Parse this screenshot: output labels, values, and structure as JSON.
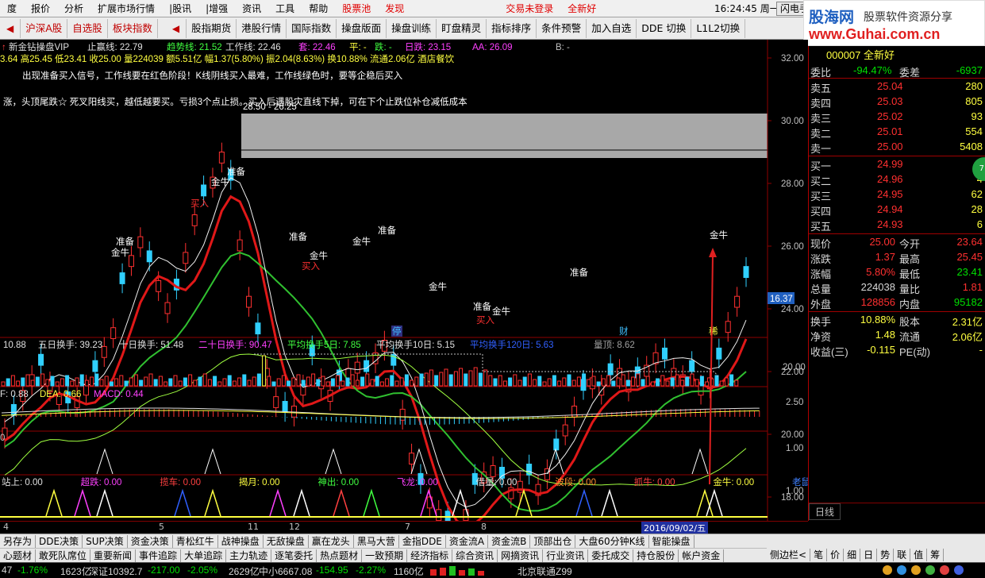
{
  "menu": {
    "items": [
      "度",
      "报价",
      "分析",
      "扩展市场行情",
      "|股讯",
      "|增强",
      "资讯",
      "工具",
      "帮助"
    ],
    "red_items": [
      "股票池",
      "发现"
    ],
    "trade_status": "交易未登录",
    "trade_link": "全新好",
    "clock": "16:24:45 周一",
    "flash_button": "闪电手"
  },
  "toolbar": {
    "buttons": [
      "沪深A股",
      "自选股",
      "板块指数",
      "股指期货",
      "港股行情",
      "国际指数",
      "操盘版面",
      "操盘训练",
      "盯盘精灵",
      "指标排序",
      "条件预警",
      "加入自选",
      "DDE 切换",
      "L1L2切换"
    ]
  },
  "watermark": {
    "title": "股海网",
    "subtitle": "股票软件资源分享",
    "url": "www.Guhai.com.cn"
  },
  "chart": {
    "header": {
      "stock_name": "新金钻操盘VIP",
      "stop_line": "止赢线: 22.79",
      "trend_line": "趋势线: 21.52",
      "work_line": "工作线: 22.46",
      "trap": "套: 22.46",
      "flat": "平: -",
      "fall": "跌: -",
      "day_line": "日跌: 23.15",
      "aa": "AA: 26.09",
      "b": "B: -"
    },
    "quote_line": "3.64 高25.45 低23.41 收25.00 量224039 额5.51亿 幅1.37(5.80%) 振2.04(8.63%) 换10.88% 流通2.06亿 酒店餐饮",
    "notice1": "出现准备买入信号，工作线要在红色阶段！K线阴线买入最难，工作线绿色时，要等企稳后买入",
    "notice2": "涨，头顶尾跌☆ 死叉阳线买，越低越要买。亏损3个点止损。买入后遇股灾直线下掉，可在下个止跌位补仓减低成本",
    "gray_box_label": "28.50 - 26.25",
    "price_axis": [
      "32.00",
      "30.00",
      "28.00",
      "26.00",
      "24.00",
      "22.00",
      "20.00",
      "18.00",
      "16.00"
    ],
    "current_price_tag": "16.37",
    "signal_labels": [
      "准备",
      "金牛",
      "买入",
      "金牛",
      "准备",
      "准备",
      "金牛",
      "买入",
      "金牛",
      "准备",
      "金牛",
      "准备",
      "金牛",
      "买入",
      "准备",
      "金牛"
    ],
    "markers": {
      "halt": "停",
      "fin": "财",
      "rare": "稀"
    },
    "turnover_header": {
      "t1": "10.88",
      "five": "五日换手: 39.23",
      "ten": "十日换手: 51.48",
      "twenty": "二十日换手: 90.47",
      "avg5": "平均换手5日: 7.85",
      "avg10": "平均换手10日: 5.15",
      "avg120": "平均换手120日: 5.63",
      "vol_top": "量顶: 8.62"
    },
    "turnover_axis": "20.00",
    "macd_header": {
      "dif": "F: 0.88",
      "dea": "DEA: 0.66",
      "macd": "MACD: 0.44"
    },
    "macd_axis": "2.50",
    "osc_axis": [
      "1.00",
      "1.00"
    ],
    "osc_zero": "0",
    "signals_header": [
      {
        "t": "站上: 0.00",
        "c": "#e0e0e0"
      },
      {
        "t": "超跌: 0.00",
        "c": "#ff40ff"
      },
      {
        "t": "揽车: 0.00",
        "c": "#ff4040"
      },
      {
        "t": "揭月: 0.00",
        "c": "#ffff40"
      },
      {
        "t": "神出: 0.00",
        "c": "#40ff40"
      },
      {
        "t": "飞龙: 0.00",
        "c": "#ff40ff"
      },
      {
        "t": "借量: 0.00",
        "c": "#e0e0e0"
      },
      {
        "t": "波段: 0.00",
        "c": "#ff9030"
      },
      {
        "t": "抓牛: 0.00",
        "c": "#ff4040"
      },
      {
        "t": "金牛: 0.00",
        "c": "#ffff40"
      },
      {
        "t": "老鼠: 0.00",
        "c": "#4080ff"
      },
      {
        "t": "涨停: 0.00",
        "c": "#e0e0e0"
      },
      {
        "t": "回抽: 0.00",
        "c": "#3060ff"
      },
      {
        "t": "会员加粗黄: 0.00",
        "c": "#e0e0e0"
      }
    ],
    "date_ticks": [
      "4",
      "5",
      "11",
      "12",
      "7",
      "8"
    ],
    "date_box": "2016/09/02/五"
  },
  "right_panel": {
    "code": "000007 全新好",
    "ratio": {
      "label": "委比",
      "value": "-94.47%",
      "label2": "委差",
      "value2": "-6937"
    },
    "asks": [
      {
        "label": "卖五",
        "price": "25.04",
        "vol": "280"
      },
      {
        "label": "卖四",
        "price": "25.03",
        "vol": "805"
      },
      {
        "label": "卖三",
        "price": "25.02",
        "vol": "93"
      },
      {
        "label": "卖二",
        "price": "25.01",
        "vol": "554"
      },
      {
        "label": "卖一",
        "price": "25.00",
        "vol": "5408"
      }
    ],
    "bids": [
      {
        "label": "买一",
        "price": "24.99",
        "vol": "2"
      },
      {
        "label": "买二",
        "price": "24.96",
        "vol": "4"
      },
      {
        "label": "买三",
        "price": "24.95",
        "vol": "62"
      },
      {
        "label": "买四",
        "price": "24.94",
        "vol": "28"
      },
      {
        "label": "买五",
        "price": "24.93",
        "vol": "6"
      }
    ],
    "stats": [
      {
        "l1": "现价",
        "v1": "25.00",
        "l2": "今开",
        "v2": "23.64",
        "c1": "c-red",
        "c2": "c-red"
      },
      {
        "l1": "涨跌",
        "v1": "1.37",
        "l2": "最高",
        "v2": "25.45",
        "c1": "c-red",
        "c2": "c-red"
      },
      {
        "l1": "涨幅",
        "v1": "5.80%",
        "l2": "最低",
        "v2": "23.41",
        "c1": "c-red",
        "c2": "c-green"
      },
      {
        "l1": "总量",
        "v1": "224038",
        "l2": "量比",
        "v2": "1.81",
        "c1": "c-white",
        "c2": "c-red"
      },
      {
        "l1": "外盘",
        "v1": "128856",
        "l2": "内盘",
        "v2": "95182",
        "c1": "c-red",
        "c2": "c-green"
      }
    ],
    "stats2": [
      {
        "l1": "换手",
        "v1": "10.88%",
        "l2": "股本",
        "v2": "2.31亿"
      },
      {
        "l1": "净资",
        "v1": "1.48",
        "l2": "流通",
        "v2": "2.06亿"
      },
      {
        "l1": "收益(三)",
        "v1": "-0.115",
        "l2": "PE(动)",
        "v2": "-"
      }
    ],
    "badge": "71",
    "day_line_btn": "日线"
  },
  "bottom1": [
    "另存为",
    "DDE决策",
    "SUP决策",
    "资金决策",
    "青松红牛",
    "战神操盘",
    "无敌操盘",
    "赢在龙头",
    "黑马大营",
    "金指DDE",
    "资金流A",
    "资金流B",
    "顶部出仓",
    "大盘60分钟K线",
    "智能操盘"
  ],
  "bottom2": [
    "心题材",
    "敢死队席位",
    "重要新闻",
    "事件追踪",
    "大单追踪",
    "主力轨迹",
    "逐笔委托",
    "热点题材",
    "一致预期",
    "经济指标",
    "综合资讯",
    "网摘资讯",
    "行业资讯",
    "委托成交",
    "持仓股份",
    "帐户资金"
  ],
  "right_tabs": [
    "侧边栏<",
    "笔",
    "价",
    "细",
    "日",
    "势",
    "联",
    "值",
    "筹"
  ],
  "status": {
    "a": "47",
    "a_chg": "-1.76%",
    "a_amt": "1623亿",
    "sz": "深证10392.7",
    "sz_chg": "-217.00",
    "sz_pct": "-2.05%",
    "sz_amt": "2629亿",
    "zx": "中小6667.08",
    "zx_chg": "-154.95",
    "zx_pct": "-2.27%",
    "zx_amt": "1160亿",
    "net": "北京联通Z99"
  }
}
